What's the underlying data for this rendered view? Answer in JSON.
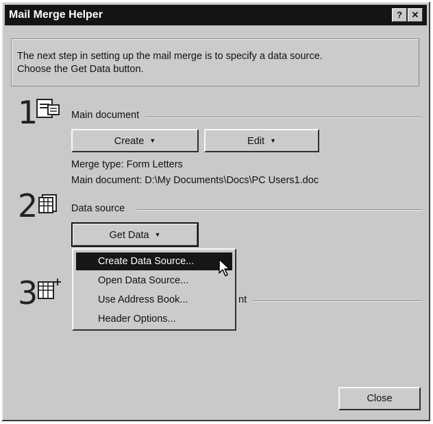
{
  "window": {
    "title": "Mail Merge Helper",
    "help_label": "?",
    "close_label": "✕"
  },
  "instructions": {
    "line1": "The next step in setting up the mail merge is to specify a data source.",
    "line2": "Choose the Get Data button."
  },
  "step1": {
    "number": "1",
    "icon": "main-document-icon",
    "title": "Main document",
    "create_label": "Create",
    "edit_label": "Edit",
    "merge_type": "Merge type: Form Letters",
    "main_document": "Main document: D:\\My Documents\\Docs\\PC Users1.doc"
  },
  "step2": {
    "number": "2",
    "icon": "data-source-icon",
    "title": "Data source",
    "get_data_label": "Get Data"
  },
  "step3": {
    "number": "3",
    "icon": "merge-icon",
    "title_fragment": "nt"
  },
  "dropdown": {
    "items": [
      {
        "label": "Create Data Source..."
      },
      {
        "label": "Open Data Source..."
      },
      {
        "label": "Use Address Book..."
      },
      {
        "label": "Header Options..."
      }
    ]
  },
  "footer": {
    "close_label": "Close"
  }
}
